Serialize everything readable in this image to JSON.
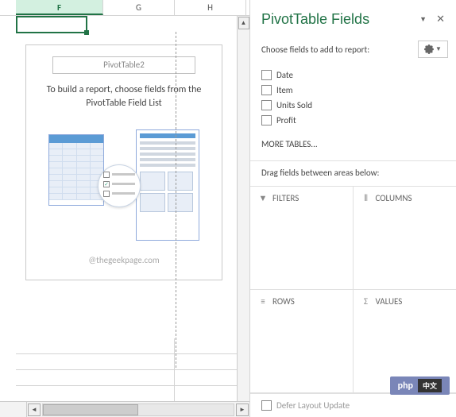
{
  "columns": {
    "f": "F",
    "g": "G",
    "h": "H"
  },
  "pivot_placeholder": {
    "name": "PivotTable2",
    "instruction_line1": "To build a report, choose fields from the",
    "instruction_line2": "PivotTable Field List",
    "watermark": "@thegeekpage.com"
  },
  "pane": {
    "title": "PivotTable Fields",
    "subtitle": "Choose fields to add to report:",
    "fields": [
      {
        "label": "Date"
      },
      {
        "label": "Item"
      },
      {
        "label": "Units Sold"
      },
      {
        "label": "Profit"
      }
    ],
    "more_tables": "MORE TABLES...",
    "drag_header": "Drag fields between areas below:",
    "areas": {
      "filters": "FILTERS",
      "columns": "COLUMNS",
      "rows": "ROWS",
      "values": "VALUES"
    },
    "footer": {
      "defer_label": "Defer Layout Update"
    }
  },
  "badge": {
    "text": "php"
  }
}
